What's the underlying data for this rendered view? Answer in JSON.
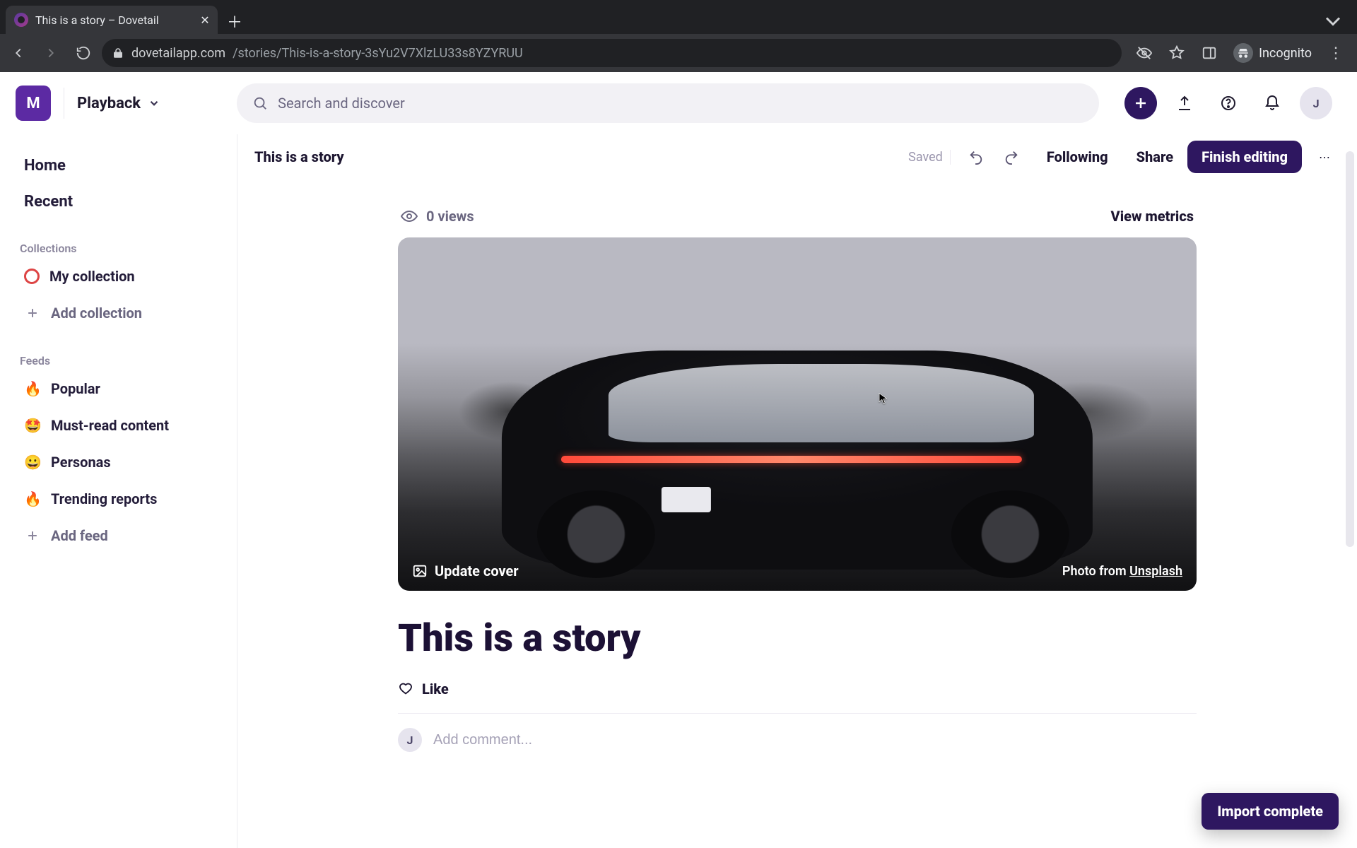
{
  "browser": {
    "tab_title": "This is a story – Dovetail",
    "url_host": "dovetailapp.com",
    "url_path": "/stories/This-is-a-story-3sYu2V7XlzLU33s8YZYRUU",
    "incognito_label": "Incognito"
  },
  "header": {
    "workspace_initial": "M",
    "space_name": "Playback",
    "search_placeholder": "Search and discover",
    "avatar_initial": "J"
  },
  "sidebar": {
    "nav": {
      "home": "Home",
      "recent": "Recent"
    },
    "collections_label": "Collections",
    "collections": [
      {
        "label": "My collection"
      }
    ],
    "add_collection": "Add collection",
    "feeds_label": "Feeds",
    "feeds": [
      {
        "emoji": "🔥",
        "label": "Popular"
      },
      {
        "emoji": "🤩",
        "label": "Must-read content"
      },
      {
        "emoji": "😀",
        "label": "Personas"
      },
      {
        "emoji": "🔥",
        "label": "Trending reports"
      }
    ],
    "add_feed": "Add feed"
  },
  "docbar": {
    "title": "This is a story",
    "saved": "Saved",
    "following": "Following",
    "share": "Share",
    "finish": "Finish editing"
  },
  "metrics": {
    "views_text": "0 views",
    "view_metrics": "View metrics"
  },
  "cover": {
    "update": "Update cover",
    "credit_prefix": "Photo from ",
    "credit_link": "Unsplash"
  },
  "story": {
    "title": "This is a story",
    "like": "Like",
    "comment_placeholder": "Add comment...",
    "comment_avatar_initial": "J"
  },
  "toast": {
    "text": "Import complete"
  }
}
